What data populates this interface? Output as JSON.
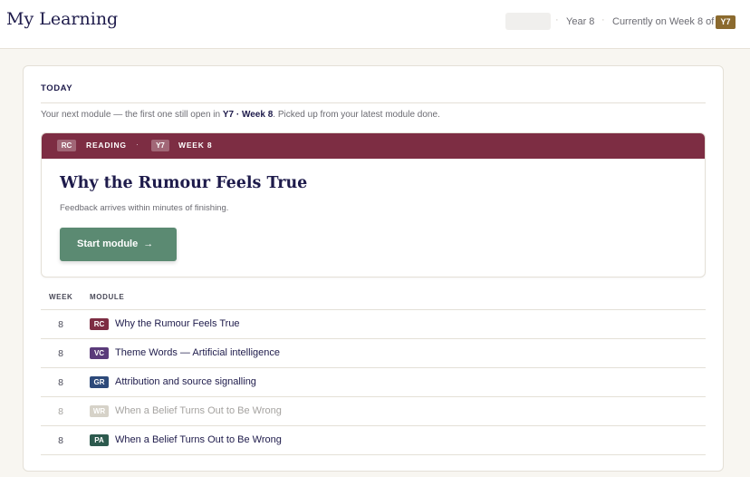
{
  "header": {
    "title": "My Learning",
    "year_label": "Year 8",
    "current_text": "Currently on Week 8 of",
    "current_badge": "Y7",
    "separator": "·"
  },
  "today": {
    "section_label": "TODAY",
    "next_prefix": "Your next module — the first one still open in ",
    "next_year": "Y7",
    "next_dot": " · ",
    "next_week": "Week 8",
    "next_suffix": ". Picked up from your latest module done."
  },
  "featured": {
    "subject_code": "RC",
    "subject_name": "READING",
    "dot": "·",
    "year_code": "Y7",
    "week_label": "WEEK 8",
    "title": "Why the Rumour Feels True",
    "subtitle": "Feedback arrives within minutes of finishing.",
    "button_label": "Start module",
    "button_arrow": "→",
    "accent_color": "#7d2d43",
    "button_color": "#5b8a72"
  },
  "table": {
    "col_week": "WEEK",
    "col_module": "MODULE",
    "rows": [
      {
        "week": "8",
        "code": "RC",
        "color": "#7d2d43",
        "name": "Why the Rumour Feels True",
        "muted": false
      },
      {
        "week": "8",
        "code": "VC",
        "color": "#5a3b7a",
        "name": "Theme Words — Artificial intelligence",
        "muted": false
      },
      {
        "week": "8",
        "code": "GR",
        "color": "#2d4a7a",
        "name": "Attribution and source signalling",
        "muted": false
      },
      {
        "week": "8",
        "code": "WR",
        "color": "#d6d2c8",
        "name": "When a Belief Turns Out to Be Wrong",
        "muted": true
      },
      {
        "week": "8",
        "code": "PA",
        "color": "#2d5a4e",
        "name": "When a Belief Turns Out to Be Wrong",
        "muted": false
      }
    ]
  }
}
